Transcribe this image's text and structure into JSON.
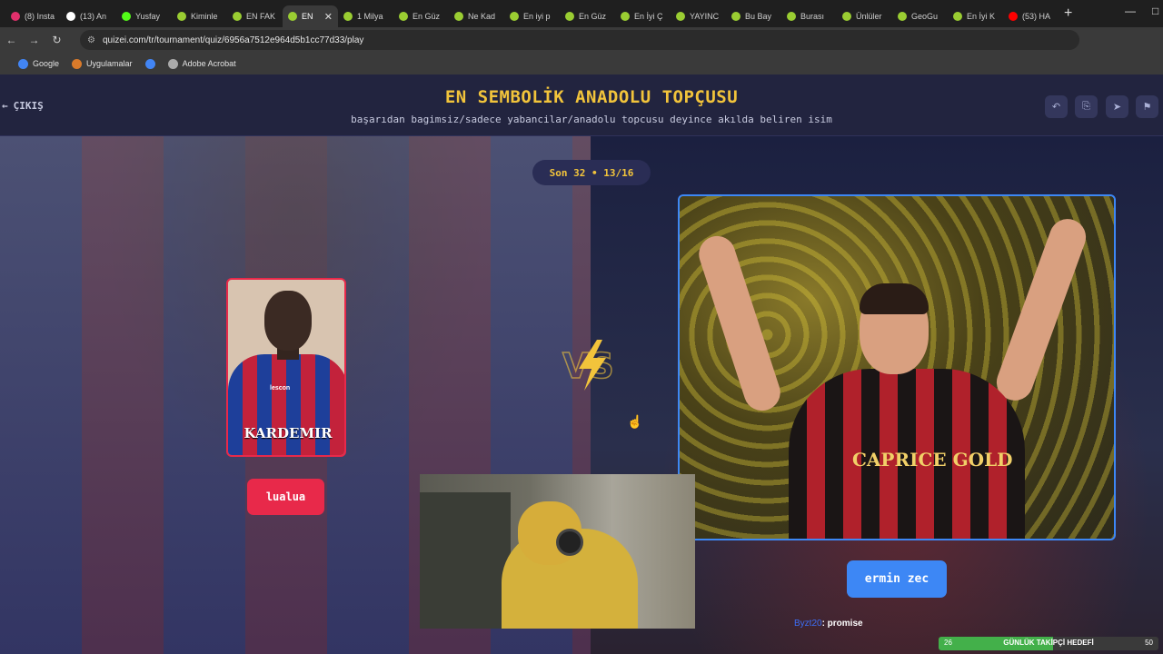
{
  "browser": {
    "tabs": [
      {
        "title": "(8) Insta",
        "color": "#e1306c"
      },
      {
        "title": "(13) An",
        "color": "#ffffff"
      },
      {
        "title": "Yusfay",
        "color": "#53fc18"
      },
      {
        "title": "Kiminle",
        "color": "#9acd32"
      },
      {
        "title": "EN FAK",
        "color": "#9acd32"
      },
      {
        "title": "EN",
        "color": "#9acd32",
        "active": true
      },
      {
        "title": "1 Milya",
        "color": "#9acd32"
      },
      {
        "title": "En Güz",
        "color": "#9acd32"
      },
      {
        "title": "Ne Kad",
        "color": "#9acd32"
      },
      {
        "title": "En iyi p",
        "color": "#9acd32"
      },
      {
        "title": "En Güz",
        "color": "#9acd32"
      },
      {
        "title": "En İyi Ç",
        "color": "#9acd32"
      },
      {
        "title": "YAYINC",
        "color": "#9acd32"
      },
      {
        "title": "Bu Bay",
        "color": "#9acd32"
      },
      {
        "title": "Burası",
        "color": "#9acd32"
      },
      {
        "title": "Ünlüler",
        "color": "#9acd32"
      },
      {
        "title": "GeoGu",
        "color": "#9acd32"
      },
      {
        "title": "En İyi K",
        "color": "#9acd32"
      },
      {
        "title": "(53) HA",
        "color": "#ff0000"
      }
    ],
    "url": "quizei.com/tr/tournament/quiz/6956a7512e964d5b1cc77d33/play",
    "bookmarks": [
      {
        "label": "Google",
        "color": "#4285f4"
      },
      {
        "label": "Uygulamalar",
        "color": "#d97a2a"
      },
      {
        "label": "",
        "color": "#4285f4"
      },
      {
        "label": "Adobe Acrobat",
        "color": "#aaaaaa"
      }
    ]
  },
  "quiz": {
    "exit_label": "ÇIKIŞ",
    "title": "EN SEMBOLİK ANADOLU TOPÇUSU",
    "subtitle": "başarıdan bagimsiz/sadece yabancilar/anadolu topcusu deyince akılda beliren isim",
    "round": "Son 32 • 13/16",
    "vs_label": "VS",
    "left": {
      "name": "lualua",
      "sponsor": "KARDEMIR",
      "brand": "lescon",
      "accent": "#e8294a"
    },
    "right": {
      "name": "ermin zec",
      "sponsor": "CAPRICE GOLD",
      "accent": "#3d87f5"
    }
  },
  "overlay": {
    "chat_user": "Byzt20",
    "chat_message": ": promise",
    "goal_label": "GÜNLÜK TAKİPÇİ HEDEFİ",
    "goal_current": "26",
    "goal_max": "50",
    "goal_fraction": 0.52
  }
}
